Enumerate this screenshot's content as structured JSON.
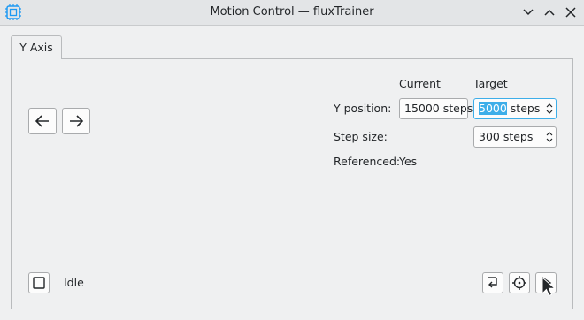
{
  "window": {
    "title": "Motion Control — fluxTrainer"
  },
  "tabs": [
    {
      "label": "Y Axis",
      "active": true
    }
  ],
  "headers": {
    "current": "Current",
    "target": "Target"
  },
  "y_position": {
    "label": "Y position:",
    "current": "15000 steps",
    "target_selected": "5000",
    "target_suffix": " steps"
  },
  "step_size": {
    "label": "Step size:",
    "value": "300 steps"
  },
  "referenced": {
    "label": "Referenced:",
    "value": "Yes"
  },
  "status": {
    "text": "Idle"
  },
  "colors": {
    "accent": "#3daee9",
    "window_bg": "#eff0f1",
    "titlebar_bg": "#e3e5e7"
  },
  "icons": [
    "app-chip-icon",
    "minimize-icon",
    "maximize-icon",
    "close-icon",
    "arrow-left-icon",
    "arrow-right-icon",
    "stop-icon",
    "return-icon",
    "reference-icon",
    "play-icon"
  ]
}
